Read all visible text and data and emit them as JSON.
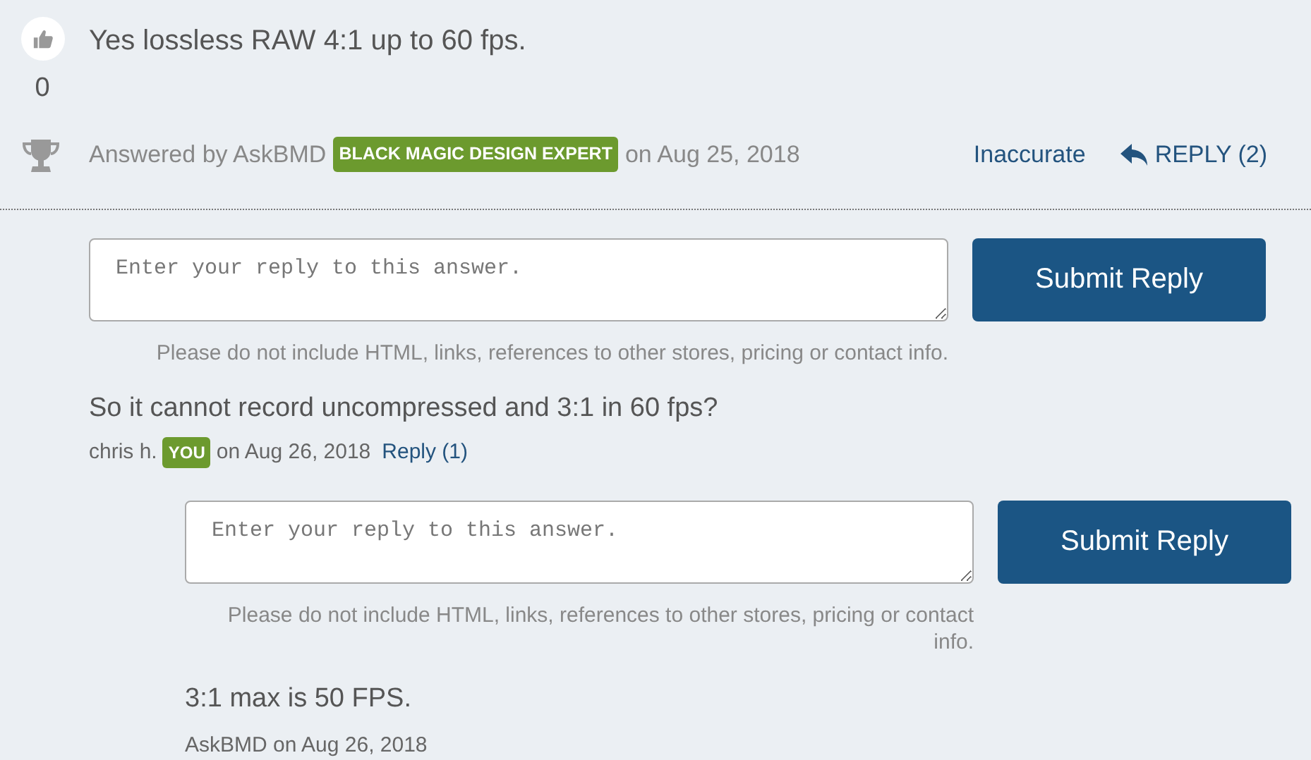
{
  "answer": {
    "votes": "0",
    "text": "Yes lossless RAW 4:1 up to 60 fps.",
    "byline_prefix": "Answered by AskBMD",
    "badge": "BLACK MAGIC DESIGN EXPERT",
    "date": "on Aug 25, 2018",
    "inaccurate_link": "Inaccurate",
    "reply_link": "REPLY (2)",
    "reply_form": {
      "placeholder": "Enter your reply to this answer.",
      "button": "Submit Reply",
      "note": "Please do not include HTML, links, references to other stores, pricing or contact info."
    },
    "comments": [
      {
        "text": "So it cannot record uncompressed and 3:1 in 60 fps?",
        "author": "chris h.",
        "badge": "YOU",
        "date": "on Aug 26, 2018",
        "reply_link": "Reply (1)",
        "reply_form": {
          "placeholder": "Enter your reply to this answer.",
          "button": "Submit Reply",
          "note": "Please do not include HTML, links, references to other stores, pricing or contact info."
        },
        "replies": [
          {
            "text": "3:1 max is 50 FPS.",
            "byline": "AskBMD on Aug 26, 2018"
          }
        ]
      }
    ]
  }
}
